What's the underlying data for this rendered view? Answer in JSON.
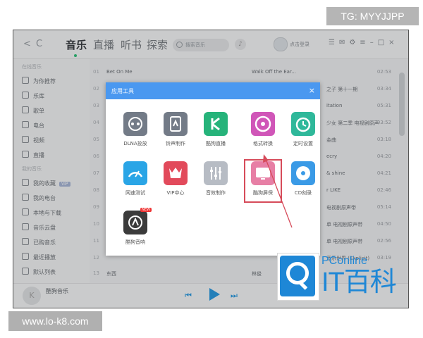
{
  "watermarks": {
    "top": "TG: MYYJJPP",
    "bottom": "www.lo-k8.com"
  },
  "header": {
    "tabs": [
      "音乐",
      "直播",
      "听书",
      "探索"
    ],
    "active_tab": "音乐",
    "search_placeholder": "搜索音乐",
    "login": "点击登录"
  },
  "sidebar": {
    "groups": [
      "在线音乐",
      "我的音乐"
    ],
    "online_items": [
      "为你推荐",
      "乐库",
      "歌单",
      "电台",
      "视频",
      "直播"
    ],
    "my_items": [
      "我的收藏",
      "我的电台",
      "本地与下载",
      "音乐云盘",
      "已购音乐",
      "最近播放",
      "默认列表"
    ],
    "vip_tag": "VIP"
  },
  "list": {
    "rows": [
      {
        "n": "01",
        "title": "Bet On Me",
        "album": "Walk Off the Ear...",
        "artist": "Bet On Me",
        "time": "02:53"
      },
      {
        "n": "02",
        "title": "",
        "album": "",
        "artist": "之子 第十一期",
        "time": "03:34"
      },
      {
        "n": "03",
        "title": "",
        "album": "",
        "artist": "itation",
        "time": "05:31"
      },
      {
        "n": "04",
        "title": "",
        "album": "",
        "artist": "少女 第二季 电视剧原声",
        "time": "03:52"
      },
      {
        "n": "05",
        "title": "",
        "album": "",
        "artist": "金曲",
        "time": "03:18"
      },
      {
        "n": "06",
        "title": "",
        "album": "",
        "artist": "ecry",
        "time": "04:20"
      },
      {
        "n": "07",
        "title": "",
        "album": "",
        "artist": "& shine",
        "time": "04:21"
      },
      {
        "n": "08",
        "title": "",
        "album": "",
        "artist": "r LIKE",
        "time": "02:46"
      },
      {
        "n": "09",
        "title": "",
        "album": "",
        "artist": "电视剧原声带",
        "time": "05:14"
      },
      {
        "n": "10",
        "title": "",
        "album": "",
        "artist": "单 电视剧原声带",
        "time": "04:50"
      },
      {
        "n": "11",
        "title": "",
        "album": "",
        "artist": "单 电视剧原声带",
        "time": "02:56"
      },
      {
        "n": "12",
        "title": "",
        "album": "",
        "artist": "音乐世界 (Explicit)",
        "time": "03:19"
      },
      {
        "n": "13",
        "title": "东西",
        "album": "林俊",
        "artist": "",
        "time": ""
      }
    ]
  },
  "player": {
    "title": "酷狗音乐"
  },
  "dialog": {
    "title": "应用工具",
    "tools": [
      {
        "label": "DLNA投放",
        "icon": "dlna-icon",
        "color": "#737b87"
      },
      {
        "label": "铃声制作",
        "icon": "ringtone-icon",
        "color": "#737b87"
      },
      {
        "label": "酷狗直播",
        "icon": "live-icon",
        "color": "#26b37a"
      },
      {
        "label": "格式转换",
        "icon": "convert-icon",
        "color": "#d056b8"
      },
      {
        "label": "定时设置",
        "icon": "alarm-icon",
        "color": "#2fb89a"
      },
      {
        "label": "网速测试",
        "icon": "speed-icon",
        "color": "#2aa5e6"
      },
      {
        "label": "VIP中心",
        "icon": "vip-icon",
        "color": "#e24a5b"
      },
      {
        "label": "音效制作",
        "icon": "equalizer-icon",
        "color": "#b7bcc4"
      },
      {
        "label": "酷狗屏保",
        "icon": "screensaver-icon",
        "color": "#e77fa5"
      },
      {
        "label": "CD刻录",
        "icon": "cd-icon",
        "color": "#3a9ae6"
      },
      {
        "label": "酷狗音响",
        "icon": "speaker-icon",
        "color": "#3b3b3b"
      }
    ],
    "new_badge": "NEW"
  },
  "logo": {
    "brand": "PConline",
    "name": "IT百科"
  }
}
